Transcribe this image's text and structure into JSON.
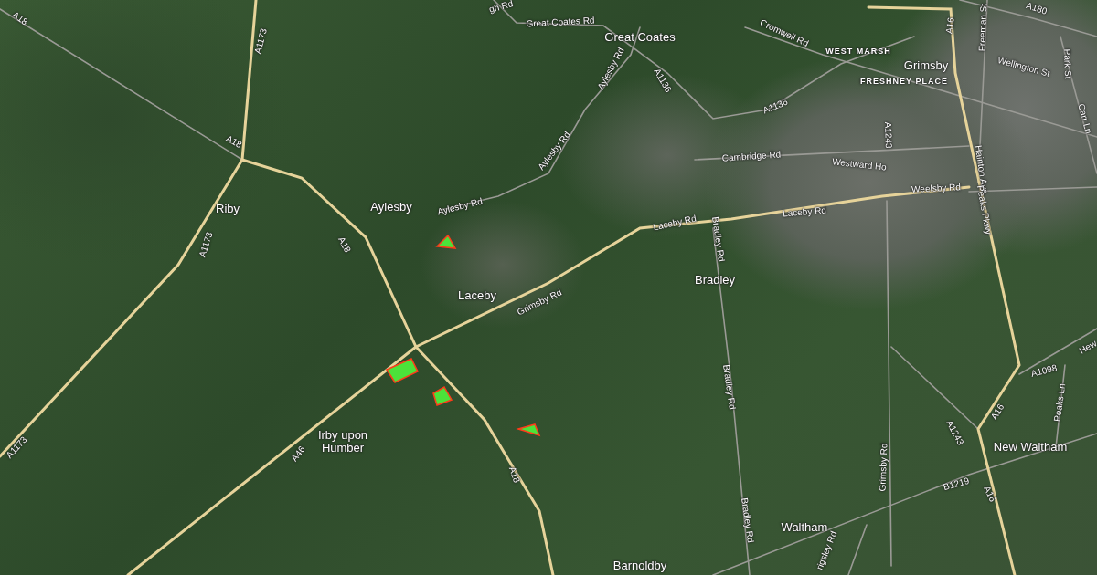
{
  "map": {
    "labels": [
      {
        "kind": "road",
        "text": "gh Rd"
      },
      {
        "kind": "road",
        "text": "Great Coates Rd"
      },
      {
        "kind": "place",
        "text": "Great Coates"
      },
      {
        "kind": "road",
        "text": "A18"
      },
      {
        "kind": "road",
        "text": "A1173"
      },
      {
        "kind": "road",
        "text": "Aylesby Rd"
      },
      {
        "kind": "road",
        "text": "A1136"
      },
      {
        "kind": "road",
        "text": "Cromwell Rd"
      },
      {
        "kind": "district",
        "text": "WEST MARSH"
      },
      {
        "kind": "place",
        "text": "Grimsby"
      },
      {
        "kind": "district",
        "text": "FRESHNEY PLACE"
      },
      {
        "kind": "road",
        "text": "A16"
      },
      {
        "kind": "road",
        "text": "Freeman St"
      },
      {
        "kind": "road",
        "text": "A180"
      },
      {
        "kind": "road",
        "text": "Wellington St"
      },
      {
        "kind": "road",
        "text": "Park St"
      },
      {
        "kind": "road",
        "text": "Carr Ln"
      },
      {
        "kind": "road",
        "text": "A1136"
      },
      {
        "kind": "road",
        "text": "A1243"
      },
      {
        "kind": "road",
        "text": "Hainton Ave"
      },
      {
        "kind": "road",
        "text": "A18"
      },
      {
        "kind": "road",
        "text": "Aylesby Rd"
      },
      {
        "kind": "road",
        "text": "Cambridge Rd"
      },
      {
        "kind": "road",
        "text": "Westward Ho"
      },
      {
        "kind": "road",
        "text": "Weelsby Rd"
      },
      {
        "kind": "road",
        "text": "Peaks Pkwy"
      },
      {
        "kind": "place",
        "text": "Riby"
      },
      {
        "kind": "place",
        "text": "Aylesby"
      },
      {
        "kind": "road",
        "text": "Aylesby Rd"
      },
      {
        "kind": "road",
        "text": "Laceby Rd"
      },
      {
        "kind": "road",
        "text": "Laceby Rd"
      },
      {
        "kind": "road",
        "text": "Bradley Rd"
      },
      {
        "kind": "road",
        "text": "A1173"
      },
      {
        "kind": "road",
        "text": "A18"
      },
      {
        "kind": "place",
        "text": "Bradley"
      },
      {
        "kind": "place",
        "text": "Laceby"
      },
      {
        "kind": "road",
        "text": "Grimsby Rd"
      },
      {
        "kind": "road",
        "text": "Hew"
      },
      {
        "kind": "road",
        "text": "A1098"
      },
      {
        "kind": "road",
        "text": "Bradley Rd"
      },
      {
        "kind": "road",
        "text": "Peaks Ln"
      },
      {
        "kind": "road",
        "text": "A16"
      },
      {
        "kind": "road",
        "text": "A1243"
      },
      {
        "kind": "road",
        "text": "A1173"
      },
      {
        "kind": "place",
        "text": "Irby upon Humber"
      },
      {
        "kind": "road",
        "text": "A46"
      },
      {
        "kind": "place",
        "text": "New Waltham"
      },
      {
        "kind": "road",
        "text": "Grimsby Rd"
      },
      {
        "kind": "road",
        "text": "A18"
      },
      {
        "kind": "road",
        "text": "B1219"
      },
      {
        "kind": "road",
        "text": "A16"
      },
      {
        "kind": "road",
        "text": "Bradley Rd"
      },
      {
        "kind": "place",
        "text": "Waltham"
      },
      {
        "kind": "road",
        "text": "rigsley Rd"
      },
      {
        "kind": "place",
        "text": "Barnoldby"
      }
    ]
  }
}
